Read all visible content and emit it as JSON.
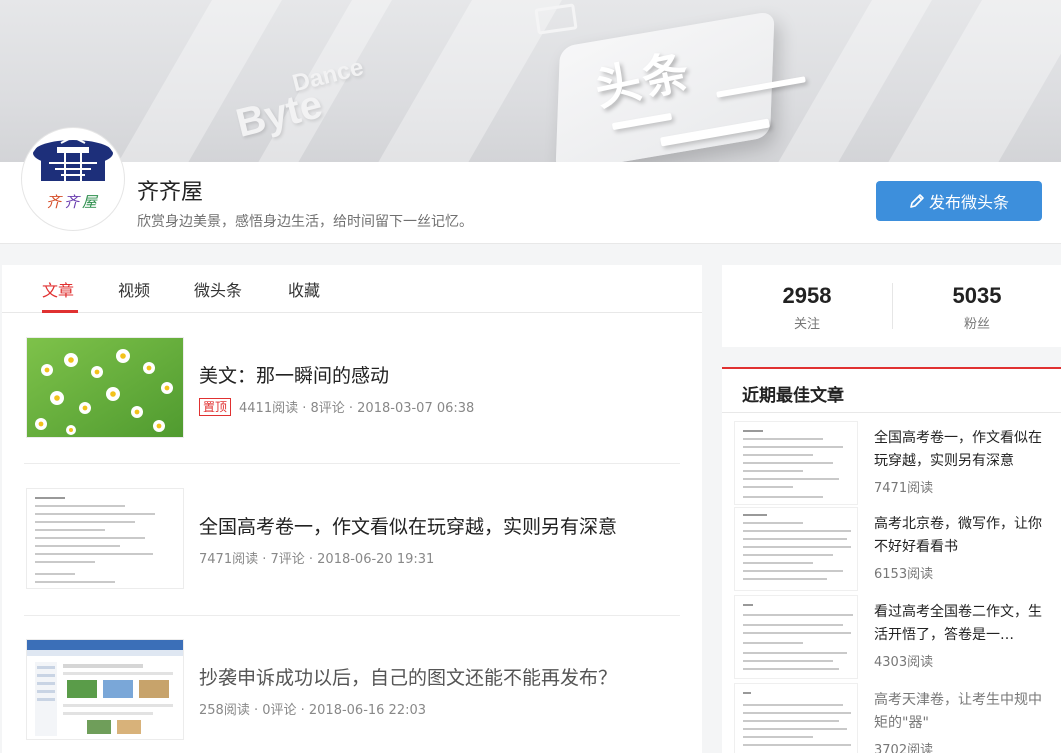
{
  "banner": {
    "brand_en_1": "Dance",
    "brand_en_2": "Byte",
    "brand_cn": "头条"
  },
  "profile": {
    "avatar_text": [
      "齐",
      "齐",
      "屋"
    ],
    "name": "齐齐屋",
    "motto": "欣赏身边美景，感悟身边生活，给时间留下一丝记忆。",
    "publish_label": "发布微头条"
  },
  "tabs": [
    {
      "label": "文章",
      "active": true
    },
    {
      "label": "视频",
      "active": false
    },
    {
      "label": "微头条",
      "active": false
    },
    {
      "label": "收藏",
      "active": false
    }
  ],
  "articles": [
    {
      "title": "美文：那一瞬间的感动",
      "pinned_label": "置顶",
      "meta": "4411阅读 · 8评论 · 2018-03-07 06:38",
      "thumb_icon": "daisy-photo"
    },
    {
      "title": "全国高考卷一，作文看似在玩穿越，实则另有深意",
      "meta": "7471阅读 · 7评论 · 2018-06-20 19:31",
      "thumb_icon": "document-page"
    },
    {
      "title": "抄袭申诉成功以后，自己的图文还能不能再发布？",
      "meta": "258阅读 · 0评论 · 2018-06-16 22:03",
      "thumb_icon": "screenshot-page"
    }
  ],
  "stats": {
    "following_count": "2958",
    "following_label": "关注",
    "fans_count": "5035",
    "fans_label": "粉丝"
  },
  "best": {
    "title": "近期最佳文章",
    "items": [
      {
        "title": "全国高考卷一，作文看似在玩穿越，实则另有深意",
        "reads": "7471阅读"
      },
      {
        "title": "高考北京卷，微写作，让你不好好看看书",
        "reads": "6153阅读"
      },
      {
        "title": "看过高考全国卷二作文，生活开悟了，答卷是一…",
        "reads": "4303阅读"
      },
      {
        "title": "高考天津卷，让考生中规中矩的\"器\"",
        "reads": "3702阅读"
      }
    ]
  },
  "colors": {
    "accent_red": "#e03131",
    "button_blue": "#3d8fdc"
  }
}
